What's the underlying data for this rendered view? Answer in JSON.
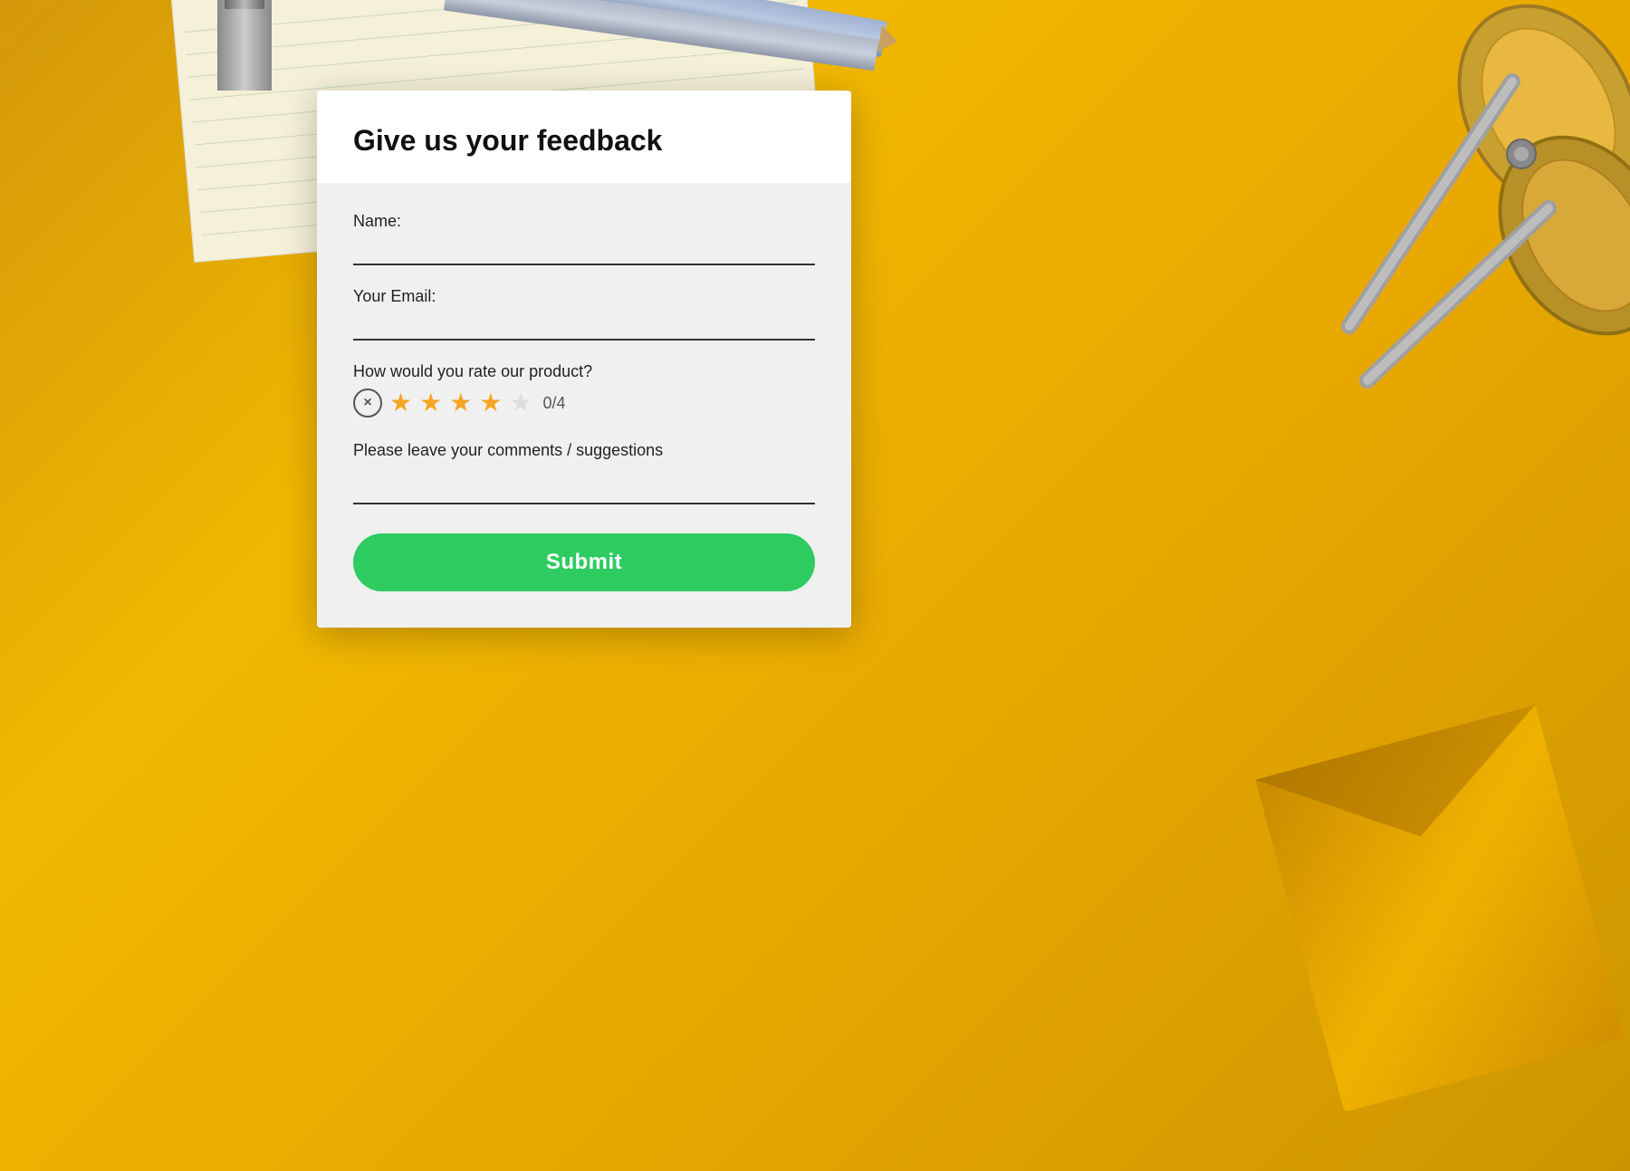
{
  "page": {
    "background_color": "#e8a800"
  },
  "form": {
    "title": "Give us your feedback",
    "header_bg": "#ffffff",
    "body_bg": "#f0f0f0",
    "fields": {
      "name": {
        "label": "Name:",
        "placeholder": "",
        "value": ""
      },
      "email": {
        "label": "Your Email:",
        "placeholder": "",
        "value": ""
      },
      "rating": {
        "question": "How would you rate our product?",
        "current": 4,
        "max": 5,
        "display": "0/4",
        "reset_label": "×",
        "filled_star": "★",
        "empty_star": "★"
      },
      "comments": {
        "label": "Please leave your comments / suggestions",
        "placeholder": "",
        "value": ""
      }
    },
    "submit": {
      "label": "Submit",
      "bg_color": "#2ecc60",
      "text_color": "#ffffff"
    }
  }
}
